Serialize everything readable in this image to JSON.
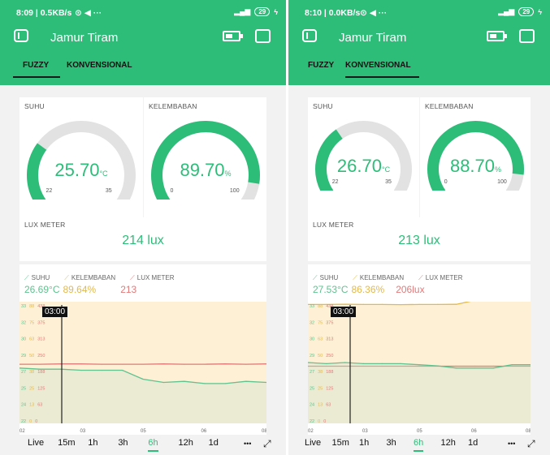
{
  "screens": [
    {
      "status": {
        "time": "8:09 | 0.5KB/s",
        "icons": "⊙ ◀ ···",
        "battery": "29"
      },
      "app_title": "Jamur Tiram",
      "tabs": [
        {
          "label": "FUZZY",
          "active": true
        },
        {
          "label": "KONVENSIONAL",
          "active": false
        }
      ],
      "suhu": {
        "label": "SUHU",
        "value": "25.70",
        "unit": "°C",
        "min": "22",
        "max": "35"
      },
      "kelembaban": {
        "label": "KELEMBABAN",
        "value": "89.70",
        "unit": "%",
        "min": "0",
        "max": "100"
      },
      "lux": {
        "label": "LUX METER",
        "value": "214 lux"
      },
      "legend": {
        "suhu": "SUHU",
        "kelembaban": "KELEMBABAN",
        "lux": "LUX METER"
      },
      "live_values": {
        "suhu": "26.69°C",
        "kelembaban": "89.64%",
        "lux": "213"
      },
      "cursor_label": "03:00",
      "x_ticks": [
        "02",
        "03",
        "05",
        "06",
        "08"
      ],
      "y_ticks": [
        {
          "a": "33",
          "b": "88",
          "c": "438"
        },
        {
          "a": "32",
          "b": "75",
          "c": "375"
        },
        {
          "a": "30",
          "b": "63",
          "c": "313"
        },
        {
          "a": "29",
          "b": "50",
          "c": "250"
        },
        {
          "a": "27",
          "b": "38",
          "c": "188"
        },
        {
          "a": "25",
          "b": "25",
          "c": "125"
        },
        {
          "a": "24",
          "b": "13",
          "c": "63"
        },
        {
          "a": "22",
          "b": "0",
          "c": "0"
        }
      ],
      "ranges": [
        "Live",
        "15m",
        "1h",
        "3h",
        "6h",
        "12h",
        "1d"
      ],
      "active_range": "6h",
      "more": "•••"
    },
    {
      "status": {
        "time": "8:10 | 0.0KB/s",
        "icons": "⊙ ◀ ···",
        "battery": "29"
      },
      "app_title": "Jamur Tiram",
      "tabs": [
        {
          "label": "FUZZY",
          "active": false
        },
        {
          "label": "KONVENSIONAL",
          "active": true
        }
      ],
      "suhu": {
        "label": "SUHU",
        "value": "26.70",
        "unit": "°C",
        "min": "22",
        "max": "35"
      },
      "kelembaban": {
        "label": "KELEMBABAN",
        "value": "88.70",
        "unit": "%",
        "min": "0",
        "max": "100"
      },
      "lux": {
        "label": "LUX METER",
        "value": "213 lux"
      },
      "legend": {
        "suhu": "SUHU",
        "kelembaban": "KELEMBABAN",
        "lux": "LUX METER"
      },
      "live_values": {
        "suhu": "27.53°C",
        "kelembaban": "86.36%",
        "lux": "206lux"
      },
      "cursor_label": "03:00",
      "x_ticks": [
        "02",
        "03",
        "05",
        "06",
        "08"
      ],
      "y_ticks": [
        {
          "a": "33",
          "b": "88",
          "c": "438"
        },
        {
          "a": "32",
          "b": "75",
          "c": "375"
        },
        {
          "a": "30",
          "b": "63",
          "c": "313"
        },
        {
          "a": "29",
          "b": "50",
          "c": "250"
        },
        {
          "a": "27",
          "b": "38",
          "c": "188"
        },
        {
          "a": "25",
          "b": "25",
          "c": "125"
        },
        {
          "a": "24",
          "b": "13",
          "c": "63"
        },
        {
          "a": "22",
          "b": "0",
          "c": "0"
        }
      ],
      "ranges": [
        "Live",
        "15m",
        "1h",
        "3h",
        "6h",
        "12h",
        "1d"
      ],
      "active_range": "6h",
      "more": "•••"
    }
  ],
  "colors": {
    "accent": "#2ebd79",
    "suhu": "#5fc28f",
    "kelembaban": "#e4b94a",
    "lux": "#e07a7a"
  },
  "chart_data": [
    {
      "type": "line",
      "x": [
        "02:00",
        "02:30",
        "03:00",
        "03:30",
        "04:00",
        "04:30",
        "05:00",
        "05:30",
        "06:00",
        "06:30",
        "07:00",
        "07:30",
        "08:00"
      ],
      "series": [
        {
          "name": "SUHU",
          "unit": "°C",
          "values": [
            27.0,
            26.9,
            26.9,
            26.8,
            26.8,
            26.8,
            26.0,
            25.7,
            25.8,
            25.6,
            25.6,
            25.8,
            25.7
          ]
        },
        {
          "name": "KELEMBABAN",
          "unit": "%",
          "values": [
            89.6,
            89.7,
            89.6,
            89.7,
            89.7,
            89.6,
            89.8,
            89.8,
            89.7,
            89.8,
            89.8,
            89.7,
            89.7
          ]
        },
        {
          "name": "LUX METER",
          "unit": "lux",
          "values": [
            213,
            213,
            214,
            214,
            213,
            213,
            213,
            214,
            213,
            213,
            214,
            213,
            214
          ]
        }
      ],
      "ylim_suhu": [
        22,
        33
      ],
      "ylim_kelembaban": [
        0,
        88
      ],
      "ylim_lux": [
        0,
        438
      ],
      "grid": false
    },
    {
      "type": "line",
      "x": [
        "02:00",
        "02:30",
        "03:00",
        "03:30",
        "04:00",
        "04:30",
        "05:00",
        "05:30",
        "06:00",
        "06:30",
        "07:00",
        "07:30",
        "08:00"
      ],
      "series": [
        {
          "name": "SUHU",
          "unit": "°C",
          "values": [
            27.5,
            27.4,
            27.5,
            27.4,
            27.4,
            27.4,
            27.3,
            27.2,
            27.0,
            27.0,
            27.0,
            27.3,
            27.3
          ]
        },
        {
          "name": "KELEMBABAN",
          "unit": "%",
          "values": [
            86.0,
            86.0,
            86.2,
            86.0,
            86.0,
            85.9,
            86.0,
            86.0,
            86.1,
            89.0,
            91.0,
            89.5,
            89.0
          ]
        },
        {
          "name": "LUX METER",
          "unit": "lux",
          "values": [
            206,
            206,
            206,
            206,
            206,
            206,
            206,
            206,
            206,
            206,
            206,
            206,
            206
          ]
        }
      ],
      "ylim_suhu": [
        22,
        33
      ],
      "ylim_kelembaban": [
        0,
        88
      ],
      "ylim_lux": [
        0,
        438
      ],
      "grid": false
    }
  ]
}
